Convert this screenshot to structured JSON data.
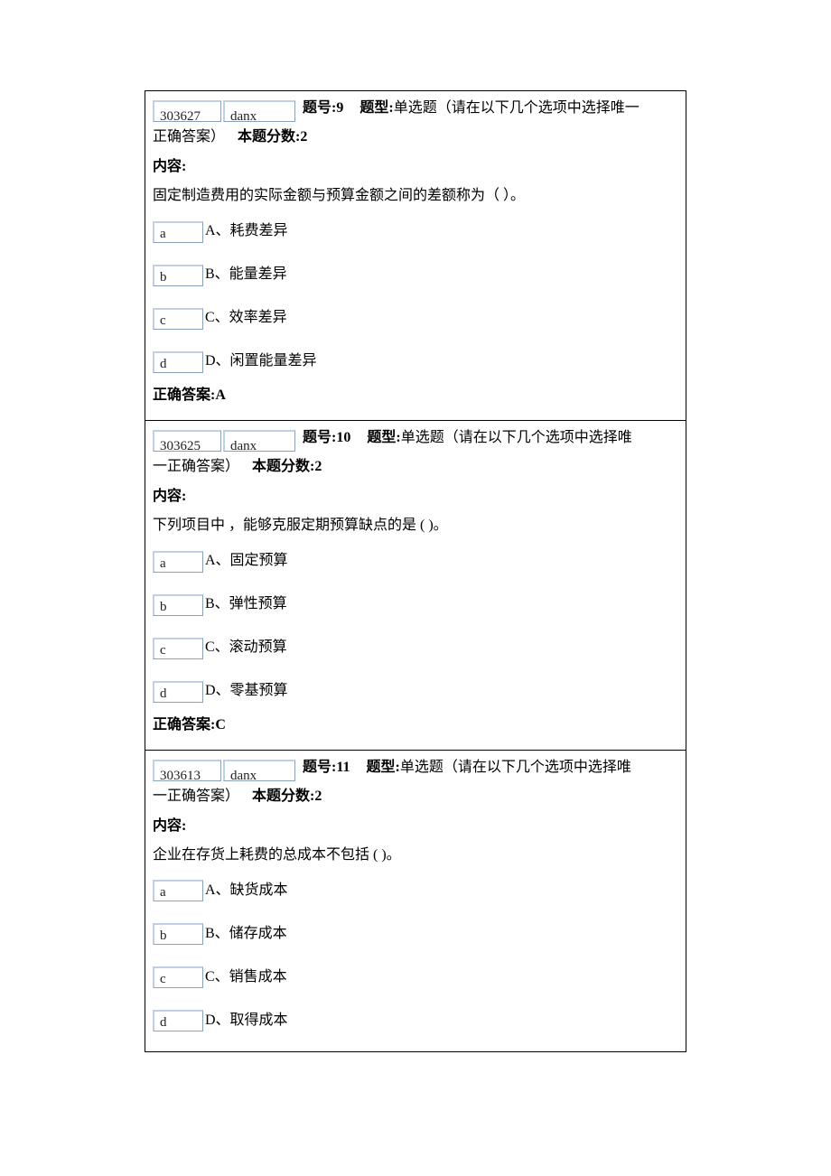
{
  "labels": {
    "qno": "题号:",
    "qtype": "题型:",
    "score": "本题分数:",
    "content": "内容:",
    "answer": "正确答案:"
  },
  "type_desc_tail_first": "单选题（请在以下几个选项中选择唯一",
  "type_desc_tail_cont": "正确答案）",
  "questions": [
    {
      "id": "303627",
      "type_code": "danx",
      "qno": "9",
      "qtype_lead": "单选题（请在以下几个选项中选择唯一",
      "score": "2",
      "content_text": "固定制造费用的实际金额与预算金额之间的差额称为（  ）。",
      "options": [
        {
          "code": "a",
          "text": "A、耗费差异"
        },
        {
          "code": "b",
          "text": "B、能量差异"
        },
        {
          "code": "c",
          "text": "C、效率差异"
        },
        {
          "code": "d",
          "text": "D、闲置能量差异"
        }
      ],
      "answer": "A"
    },
    {
      "id": "303625",
      "type_code": "danx",
      "qno": "10",
      "qtype_lead": "单选题（请在以下几个选项中选择唯",
      "score": "2",
      "content_text": "下列项目中 ，能够克服定期预算缺点的是 ( )。",
      "options": [
        {
          "code": "a",
          "text": "A、固定预算"
        },
        {
          "code": "b",
          "text": "B、弹性预算"
        },
        {
          "code": "c",
          "text": "C、滚动预算"
        },
        {
          "code": "d",
          "text": "D、零基预算"
        }
      ],
      "answer": "C",
      "cont_prefix": "一正确答案）"
    },
    {
      "id": "303613",
      "type_code": "danx",
      "qno": "11",
      "qtype_lead": "单选题（请在以下几个选项中选择唯",
      "score": "2",
      "content_text": "企业在存货上耗费的总成本不包括 ( )。",
      "options": [
        {
          "code": "a",
          "text": "A、缺货成本"
        },
        {
          "code": "b",
          "text": "B、储存成本"
        },
        {
          "code": "c",
          "text": "C、销售成本"
        },
        {
          "code": "d",
          "text": "D、取得成本"
        }
      ],
      "answer": "",
      "cont_prefix": "一正确答案）"
    }
  ]
}
